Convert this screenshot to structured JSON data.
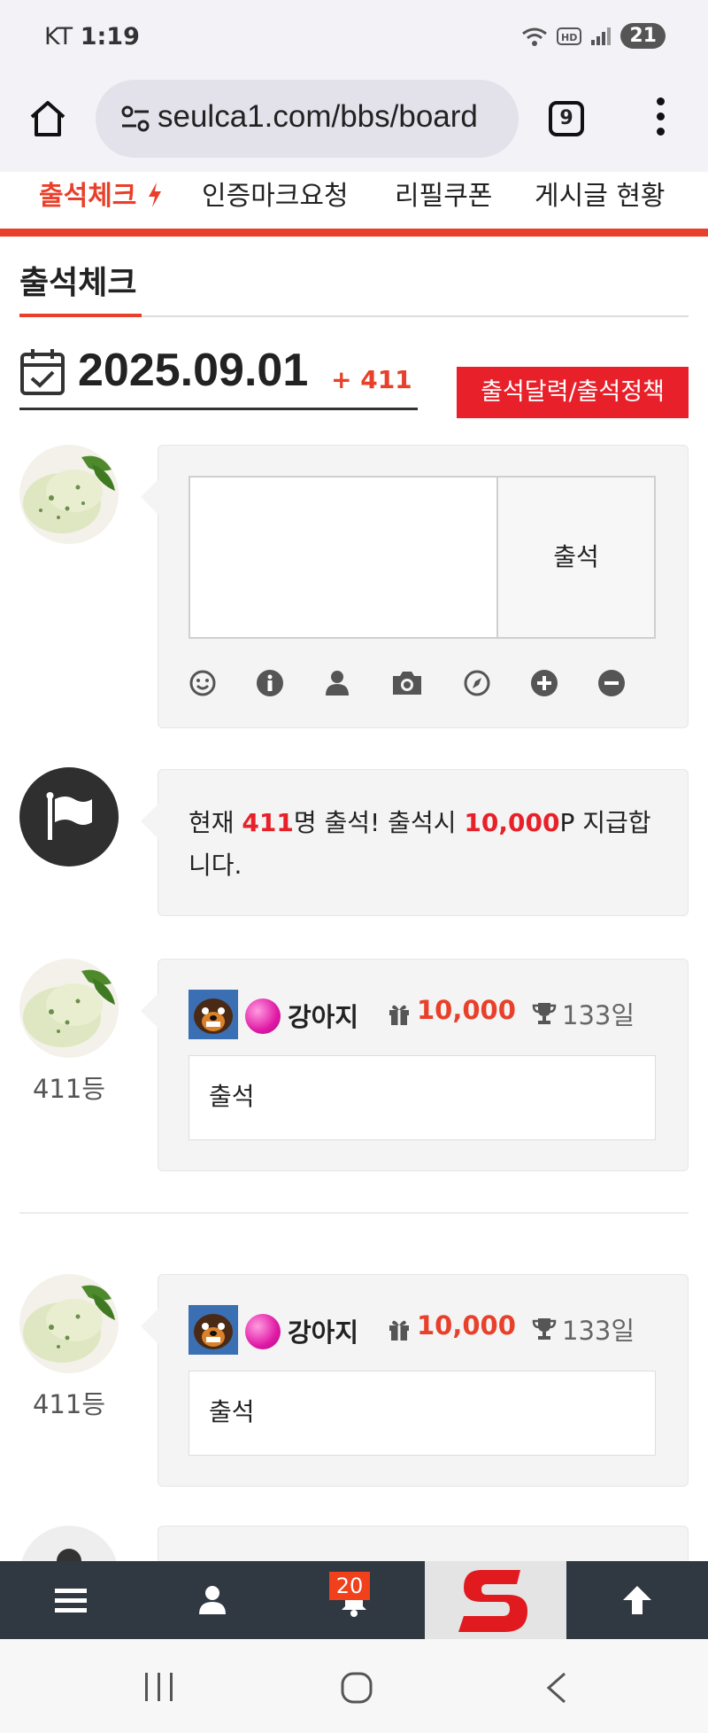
{
  "status_bar": {
    "carrier": "KT",
    "time": "1:19",
    "battery": "21"
  },
  "browser": {
    "url": "seulca1.com/bbs/board",
    "tab_count": "9"
  },
  "nav": {
    "items": [
      "출석체크",
      "인증마크요청",
      "리필쿠폰",
      "게시글 현황"
    ],
    "active_index": 0
  },
  "page": {
    "title": "출석체크",
    "date": "2025.09.01",
    "count": "+ 411",
    "calendar_button": "출석달력/출석정책"
  },
  "form": {
    "submit_label": "출석",
    "tools": [
      "smile-icon",
      "info-icon",
      "user-icon",
      "camera-icon",
      "compass-icon",
      "plus-circle-icon",
      "minus-circle-icon"
    ]
  },
  "notice": {
    "prefix": "현재 ",
    "count": "411",
    "middle": "명 출석! 출석시 ",
    "points": "10,000",
    "suffix": "P 지급합니다."
  },
  "entries": [
    {
      "rank": "411등",
      "nickname": "강아지",
      "points": "10,000",
      "days": "133일",
      "comment": "출석"
    },
    {
      "rank": "411등",
      "nickname": "강아지",
      "points": "10,000",
      "days": "133일",
      "comment": "출석"
    }
  ],
  "bottom_bar": {
    "notification_count": "20"
  },
  "colors": {
    "accent": "#e8402a",
    "button_red": "#e8202a",
    "bar_dark": "#303841"
  }
}
